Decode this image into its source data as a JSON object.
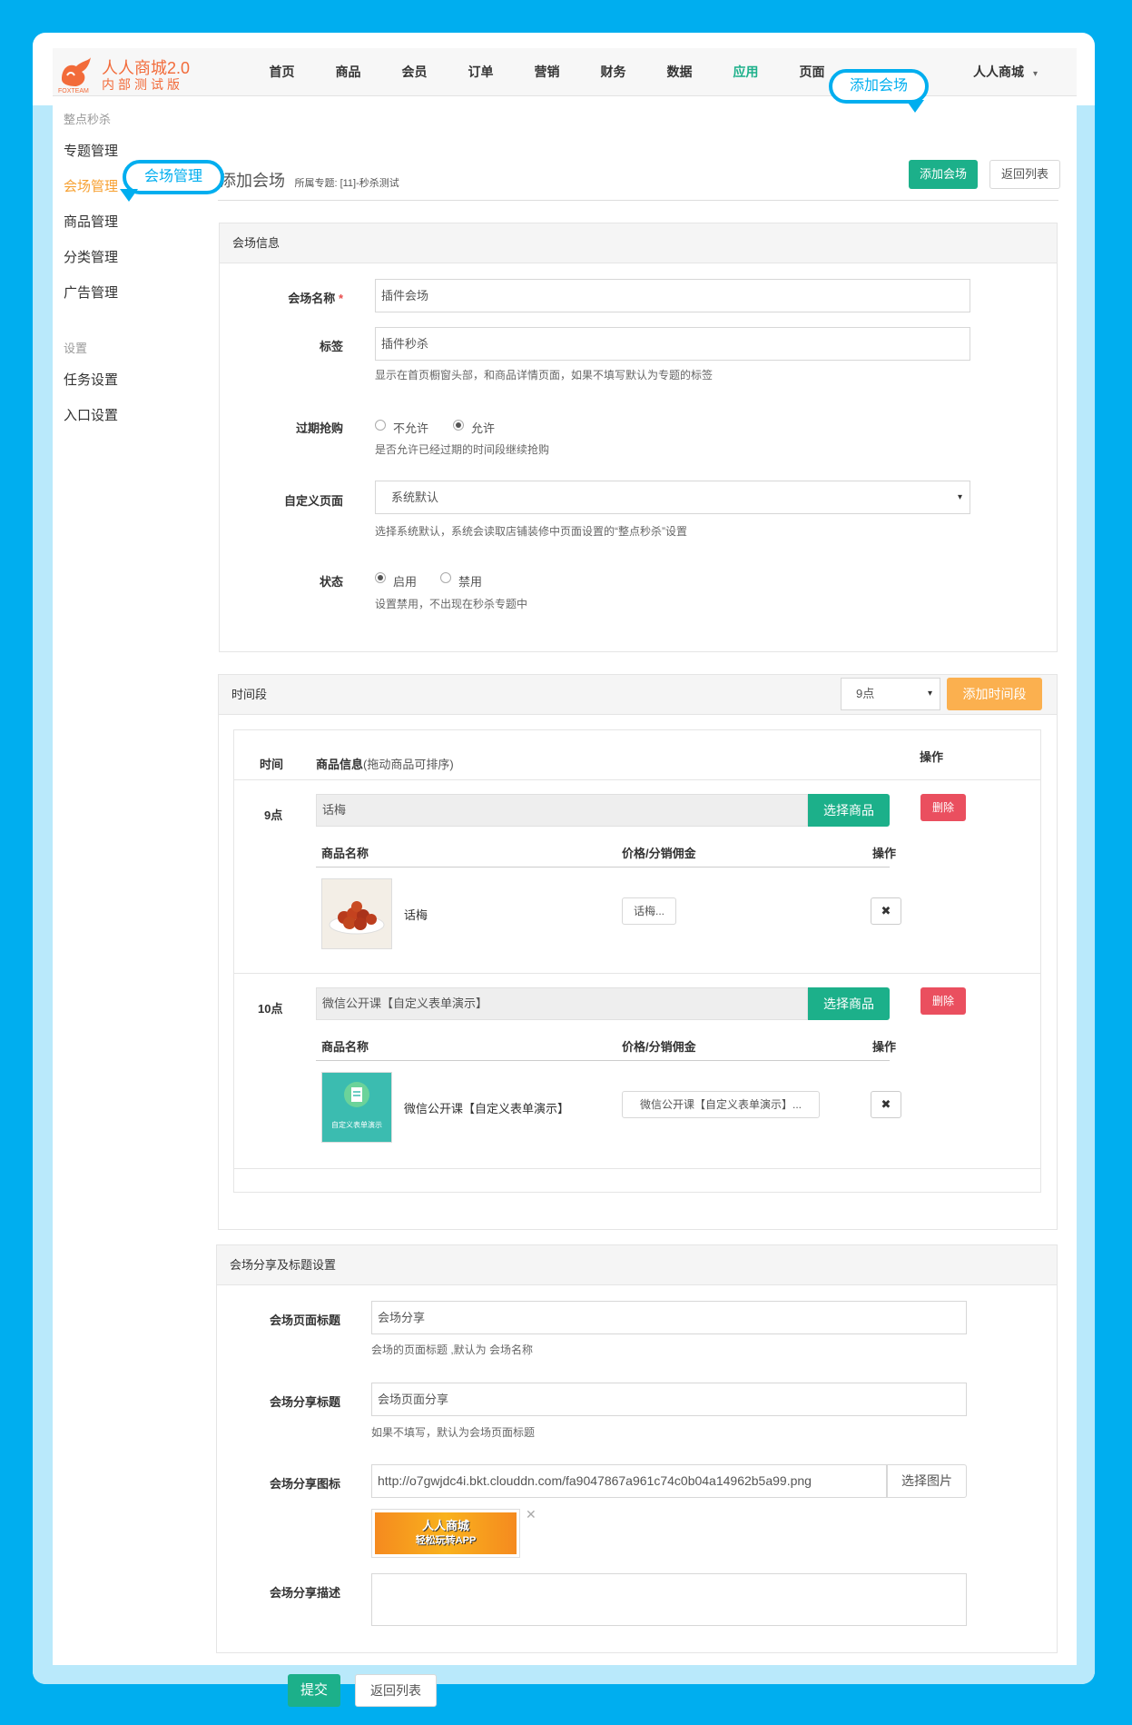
{
  "brand": {
    "title": "人人商城2.0",
    "subtitle": "内部测试版",
    "logo_small": "FOXTEAM"
  },
  "nav": {
    "items": [
      "首页",
      "商品",
      "会员",
      "订单",
      "营销",
      "财务",
      "数据",
      "应用",
      "页面"
    ],
    "active_index": 7,
    "user": "人人商城"
  },
  "sidebar": {
    "section1_title": "整点秒杀",
    "items1": [
      "专题管理",
      "会场管理",
      "商品管理",
      "分类管理",
      "广告管理"
    ],
    "active_index": 1,
    "section2_title": "设置",
    "items2": [
      "任务设置",
      "入口设置"
    ]
  },
  "callouts": {
    "add_venue": "添加会场",
    "venue_manage": "会场管理"
  },
  "header": {
    "title": "添加会场",
    "subtitle": "所属专题: [11]-秒杀测试",
    "add_button": "添加会场",
    "back_button": "返回列表"
  },
  "venue_info": {
    "panel_title": "会场信息",
    "name_label": "会场名称",
    "name_required": "*",
    "name_value": "插件会场",
    "tag_label": "标签",
    "tag_value": "插件秒杀",
    "tag_help": "显示在首页橱窗头部，和商品详情页面，如果不填写默认为专题的标签",
    "expired_label": "过期抢购",
    "expired_options": [
      "不允许",
      "允许"
    ],
    "expired_selected": 1,
    "expired_help": "是否允许已经过期的时间段继续抢购",
    "custom_page_label": "自定义页面",
    "custom_page_value": "系统默认",
    "custom_page_help": "选择系统默认，系统会读取店铺装修中页面设置的“整点秒杀”设置",
    "status_label": "状态",
    "status_options": [
      "启用",
      "禁用"
    ],
    "status_selected": 0,
    "status_help": "设置禁用，不出现在秒杀专题中"
  },
  "time_slots": {
    "panel_title": "时间段",
    "hour_select": "9点",
    "add_button": "添加时间段",
    "col_time": "时间",
    "col_goods": "商品信息",
    "col_goods_hint": "(拖动商品可排序)",
    "col_action": "操作",
    "slots": [
      {
        "time": "9点",
        "title": "话梅",
        "select_button": "选择商品",
        "delete_button": "删除",
        "sub_headers": [
          "商品名称",
          "价格/分销佣金",
          "操作"
        ],
        "goods": [
          {
            "name": "话梅",
            "price_button": "话梅...",
            "remove": "✖"
          }
        ]
      },
      {
        "time": "10点",
        "title": "微信公开课【自定义表单演示】",
        "select_button": "选择商品",
        "delete_button": "删除",
        "sub_headers": [
          "商品名称",
          "价格/分销佣金",
          "操作"
        ],
        "goods": [
          {
            "name": "微信公开课【自定义表单演示】",
            "price_button": "微信公开课【自定义表单演示】...",
            "remove": "✖",
            "thumb_text": "自定义表单演示"
          }
        ]
      }
    ]
  },
  "share": {
    "panel_title": "会场分享及标题设置",
    "page_title_label": "会场页面标题",
    "page_title_value": "会场分享",
    "page_title_help": "会场的页面标题 ,默认为 会场名称",
    "share_title_label": "会场分享标题",
    "share_title_value": "会场页面分享",
    "share_title_help": "如果不填写，默认为会场页面标题",
    "share_icon_label": "会场分享图标",
    "share_icon_value": "http://o7gwjdc4i.bkt.clouddn.com/fa9047867a961c74c0b04a14962b5a99.png",
    "select_image_button": "选择图片",
    "image_text_line1": "人人商城",
    "image_text_line2": "轻松玩转APP",
    "image_remove": "✕",
    "desc_label": "会场分享描述",
    "desc_value": ""
  },
  "footer": {
    "submit": "提交",
    "back": "返回列表"
  },
  "colors": {
    "accent_green": "#1cb08a",
    "orange": "#f7a030",
    "red": "#ea4f5f",
    "callout_blue": "#00aeef"
  }
}
